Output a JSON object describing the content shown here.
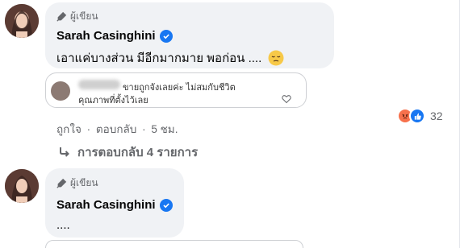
{
  "comment1": {
    "author_badge": "ผู้เขียน",
    "name": "Sarah Casinghini",
    "text": "เอาแค่บางส่วน มีอีกมากมาย พอก่อน ....",
    "emoji": "pensive-face"
  },
  "quoted": {
    "line1": "ขายถูกจังเลยค่ะ ไม่สมกับชีวิต",
    "line2": "คุณภาพที่ตั้งไว้เลย"
  },
  "actions": {
    "like": "ถูกใจ",
    "reply": "ตอบกลับ",
    "time": "5 ชม.",
    "separator": "·"
  },
  "reactions": {
    "count": "32",
    "types": [
      "angry",
      "like"
    ]
  },
  "replies_link": {
    "label": "การตอบกลับ 4 รายการ"
  },
  "comment2": {
    "author_badge": "ผู้เขียน",
    "name": "Sarah Casinghini",
    "text": "...."
  },
  "colors": {
    "bubble_bg": "#f0f2f5",
    "secondary_text": "#65676b",
    "verified_blue": "#1877f2",
    "angry_orange": "#f7714c"
  }
}
